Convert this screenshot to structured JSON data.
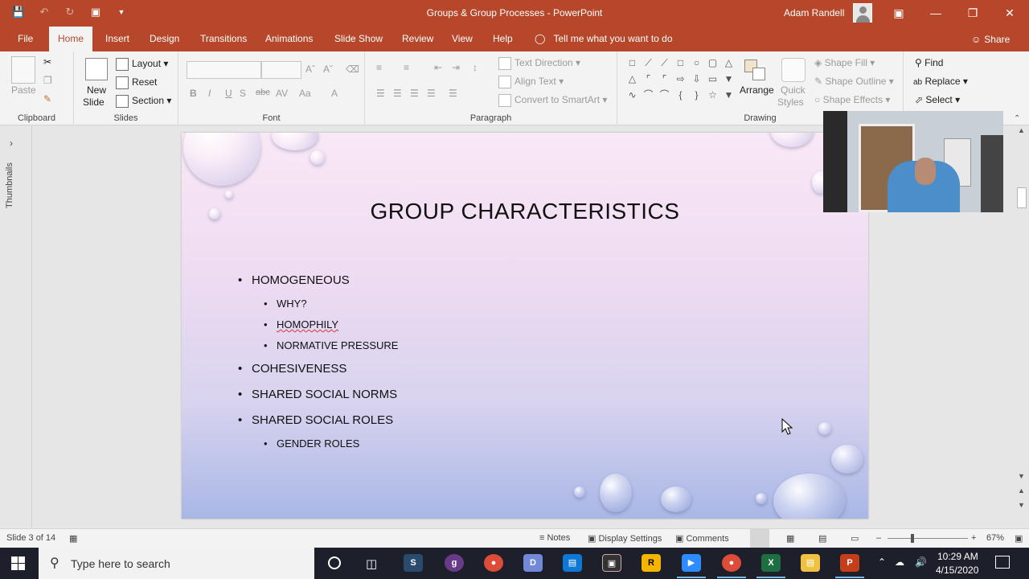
{
  "window": {
    "title": "Groups & Group Processes  -  PowerPoint",
    "user_name": "Adam Randell"
  },
  "colors": {
    "accent": "#b7472a",
    "taskbar": "#1d1f2a"
  },
  "tabs": [
    {
      "label": "File"
    },
    {
      "label": "Home"
    },
    {
      "label": "Insert"
    },
    {
      "label": "Design"
    },
    {
      "label": "Transitions"
    },
    {
      "label": "Animations"
    },
    {
      "label": "Slide Show"
    },
    {
      "label": "Review"
    },
    {
      "label": "View"
    },
    {
      "label": "Help"
    }
  ],
  "active_tab": "Home",
  "tell_me": "Tell me what you want to do",
  "share": "Share",
  "ribbon": {
    "clipboard": {
      "paste": "Paste",
      "label": "Clipboard"
    },
    "slides": {
      "new_slide_line1": "New",
      "new_slide_line2": "Slide",
      "layout": "Layout",
      "reset": "Reset",
      "section": "Section",
      "label": "Slides"
    },
    "font": {
      "bold": "B",
      "italic": "I",
      "underline": "U",
      "strike": "abc",
      "label": "Font"
    },
    "paragraph": {
      "text_direction": "Text Direction",
      "align_text": "Align Text",
      "convert_smartart": "Convert to SmartArt",
      "label": "Paragraph"
    },
    "drawing": {
      "arrange": "Arrange",
      "quick_styles_line1": "Quick",
      "quick_styles_line2": "Styles",
      "shape_fill": "Shape Fill",
      "shape_outline": "Shape Outline",
      "shape_effects": "Shape Effects",
      "label": "Drawing"
    },
    "editing": {
      "find": "Find",
      "replace": "Replace",
      "select": "Select"
    }
  },
  "thumbnails_label": "Thumbnails",
  "slide": {
    "title": "GROUP CHARACTERISTICS",
    "bullets": [
      {
        "text": "HOMOGENEOUS",
        "sub": [
          "WHY?",
          "HOMOPHILY",
          "NORMATIVE PRESSURE"
        ]
      },
      {
        "text": "COHESIVENESS",
        "sub": []
      },
      {
        "text": "SHARED SOCIAL NORMS",
        "sub": []
      },
      {
        "text": "SHARED SOCIAL ROLES",
        "sub": [
          "GENDER ROLES"
        ]
      }
    ]
  },
  "status": {
    "slide_info": "Slide 3 of 14",
    "notes": "Notes",
    "display_settings": "Display Settings",
    "comments": "Comments",
    "zoom": "67%"
  },
  "taskbar": {
    "search_placeholder": "Type here to search",
    "time": "10:29 AM",
    "date": "4/15/2020"
  }
}
